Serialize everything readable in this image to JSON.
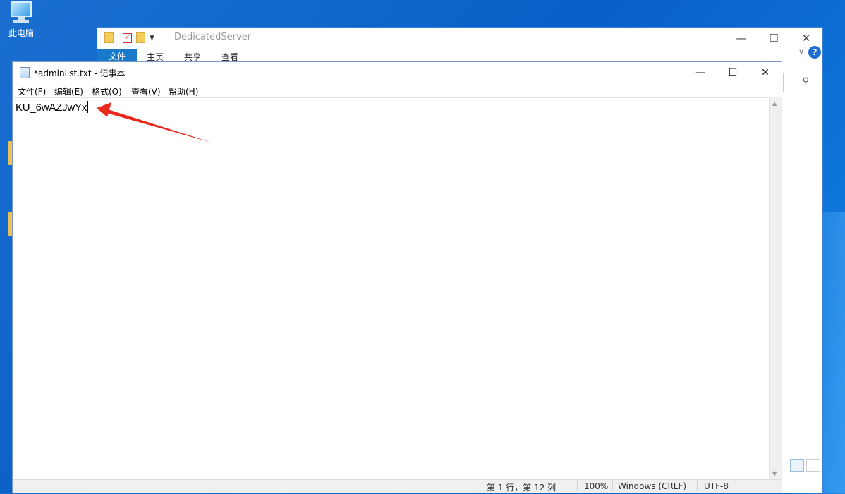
{
  "desktop": {
    "icon_label": "此电脑"
  },
  "explorer": {
    "title": "DedicatedServer",
    "ribbon_tabs": [
      "文件",
      "主页",
      "共享",
      "查看"
    ],
    "help_label": "?"
  },
  "notepad": {
    "title": "*adminlist.txt - 记事本",
    "menu": [
      "文件(F)",
      "编辑(E)",
      "格式(O)",
      "查看(V)",
      "帮助(H)"
    ],
    "content": "KU_6wAZJwYx",
    "status": {
      "position": "第 1 行，第 12 列",
      "zoom": "100%",
      "line_ending": "Windows (CRLF)",
      "encoding": "UTF-8"
    }
  },
  "window_controls": {
    "minimize": "—",
    "maximize": "☐",
    "close": "✕"
  },
  "colors": {
    "annotation_arrow": "#e8291c",
    "explorer_file_tab": "#1979ca"
  }
}
